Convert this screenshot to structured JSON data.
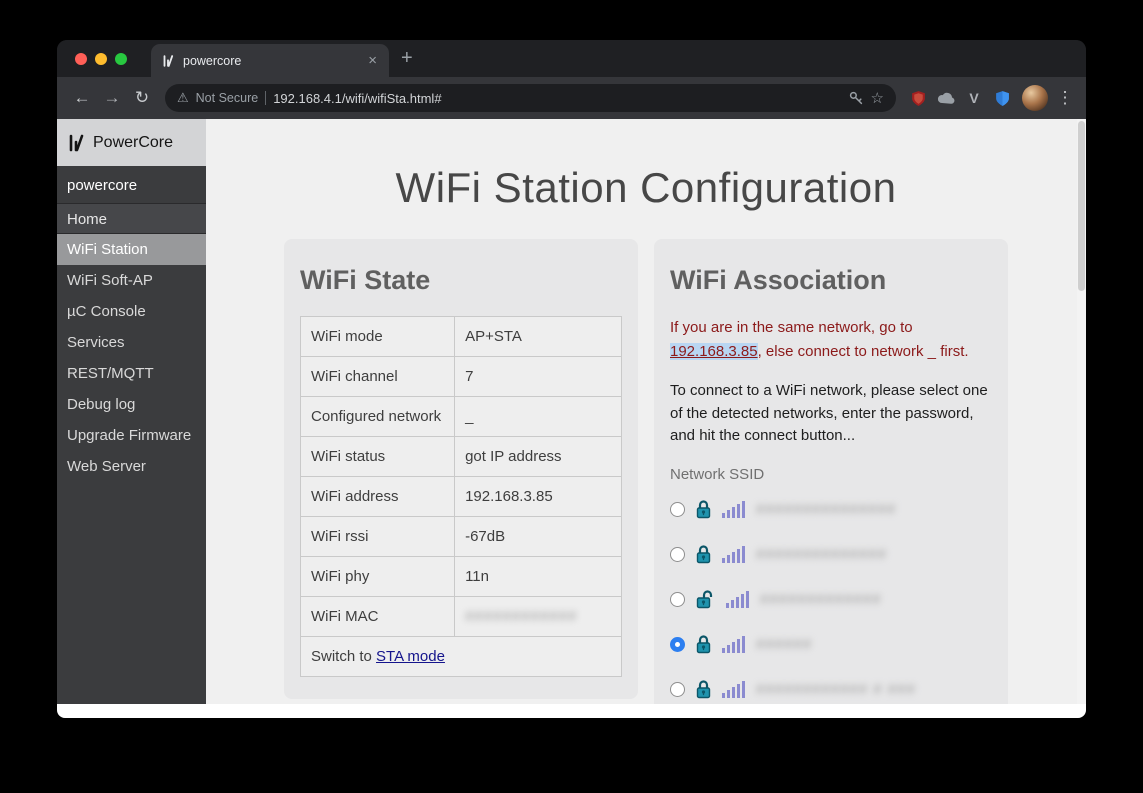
{
  "window": {
    "tab": {
      "title": "powercore",
      "close_glyph": "×",
      "new_tab_glyph": "+"
    },
    "toolbar": {
      "back_glyph": "←",
      "forward_glyph": "→",
      "reload_glyph": "↻",
      "warning_glyph": "⚠",
      "security_label": "Not Secure",
      "url": "192.168.4.1/wifi/wifiSta.html#",
      "star_glyph": "☆",
      "menu_glyph": "⋮",
      "extension_v_glyph": "V"
    }
  },
  "sidebar": {
    "brand": "PowerCore",
    "hostname": "powercore",
    "items": [
      {
        "label": "Home"
      },
      {
        "label": "WiFi Station",
        "active": true
      },
      {
        "label": "WiFi Soft-AP"
      },
      {
        "label": "µC Console"
      },
      {
        "label": "Services"
      },
      {
        "label": "REST/MQTT"
      },
      {
        "label": "Debug log"
      },
      {
        "label": "Upgrade Firmware"
      },
      {
        "label": "Web Server"
      }
    ]
  },
  "main": {
    "title": "WiFi Station Configuration",
    "state_panel": {
      "title": "WiFi State",
      "rows": [
        {
          "label": "WiFi mode",
          "value": "AP+STA"
        },
        {
          "label": "WiFi channel",
          "value": "7"
        },
        {
          "label": "Configured network",
          "value": "_"
        },
        {
          "label": "WiFi status",
          "value": "got IP address"
        },
        {
          "label": "WiFi address",
          "value": "192.168.3.85"
        },
        {
          "label": "WiFi rssi",
          "value": "-67dB"
        },
        {
          "label": "WiFi phy",
          "value": "11n"
        },
        {
          "label": "WiFi MAC",
          "value": "############",
          "redacted": true
        }
      ],
      "switch_prefix": "Switch to ",
      "switch_link": "STA mode"
    },
    "assoc_panel": {
      "title": "WiFi Association",
      "notice_pre": "If you are in the same network, go to ",
      "notice_link": "192.168.3.85",
      "notice_post": ", else connect to network _ first.",
      "instructions": "To connect to a WiFi network, please select one of the detected networks, enter the password, and hit the connect button...",
      "ssid_label": "Network SSID",
      "networks": [
        {
          "locked": true,
          "selected": false,
          "ssid_mask": "###############"
        },
        {
          "locked": true,
          "selected": false,
          "ssid_mask": "##############"
        },
        {
          "locked": false,
          "selected": false,
          "ssid_mask": "#############"
        },
        {
          "locked": true,
          "selected": true,
          "ssid_mask": "######"
        },
        {
          "locked": true,
          "selected": false,
          "ssid_mask": "############ # ###"
        }
      ]
    }
  },
  "colors": {
    "notice_red": "#8c1a1a",
    "selection_highlight": "#b9d6f2",
    "link_navy": "#14148c",
    "lock_teal": "#1f93ad",
    "signal_purple": "#8b8bd0",
    "radio_selected_blue": "#2d7ff0"
  }
}
